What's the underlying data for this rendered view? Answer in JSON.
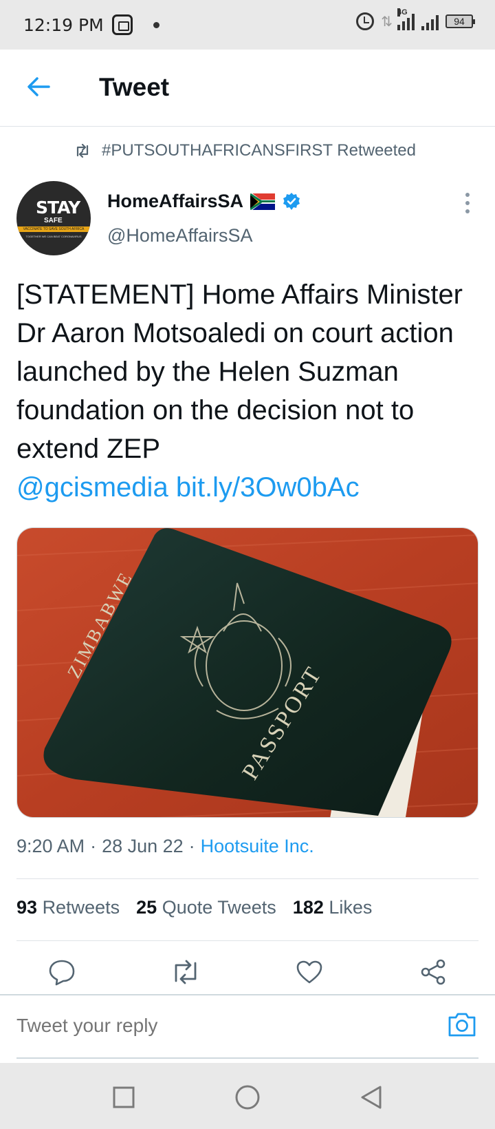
{
  "status_bar": {
    "time": "12:19 PM",
    "network": "4G",
    "battery": "94"
  },
  "header": {
    "title": "Tweet",
    "back_icon": "arrow-left-icon"
  },
  "retweet_context": {
    "text": "#PUTSOUTHAFRICANSFIRST Retweeted"
  },
  "author": {
    "display_name": "HomeAffairsSA",
    "handle": "@HomeAffairsSA",
    "avatar_text": "STAY",
    "avatar_subtext": "SAFE",
    "avatar_band": "VACCINATE TO SAVE SOUTH AFRICA",
    "avatar_small": "TOGETHER WE CAN BEAT CORONAVIRUS"
  },
  "tweet": {
    "text": "[STATEMENT] Home Affairs Minister Dr Aaron Motsoaledi on court action launched by the Helen Suzman foundation on the decision not to extend ZEP",
    "mention": "@gcismedia",
    "link": "bit.ly/3Ow0bAc",
    "timestamp": "9:20 AM",
    "date": "28 Jun 22",
    "source": "Hootsuite Inc."
  },
  "media": {
    "passport_country": "ZIMBABWE",
    "passport_label": "PASSPORT"
  },
  "stats": {
    "retweets_count": "93",
    "retweets_label": "Retweets",
    "quotes_count": "25",
    "quotes_label": "Quote Tweets",
    "likes_count": "182",
    "likes_label": "Likes"
  },
  "reply": {
    "placeholder": "Tweet your reply"
  },
  "colors": {
    "accent": "#1d9bf0",
    "text_secondary": "#536471",
    "verified": "#1d9bf0"
  }
}
